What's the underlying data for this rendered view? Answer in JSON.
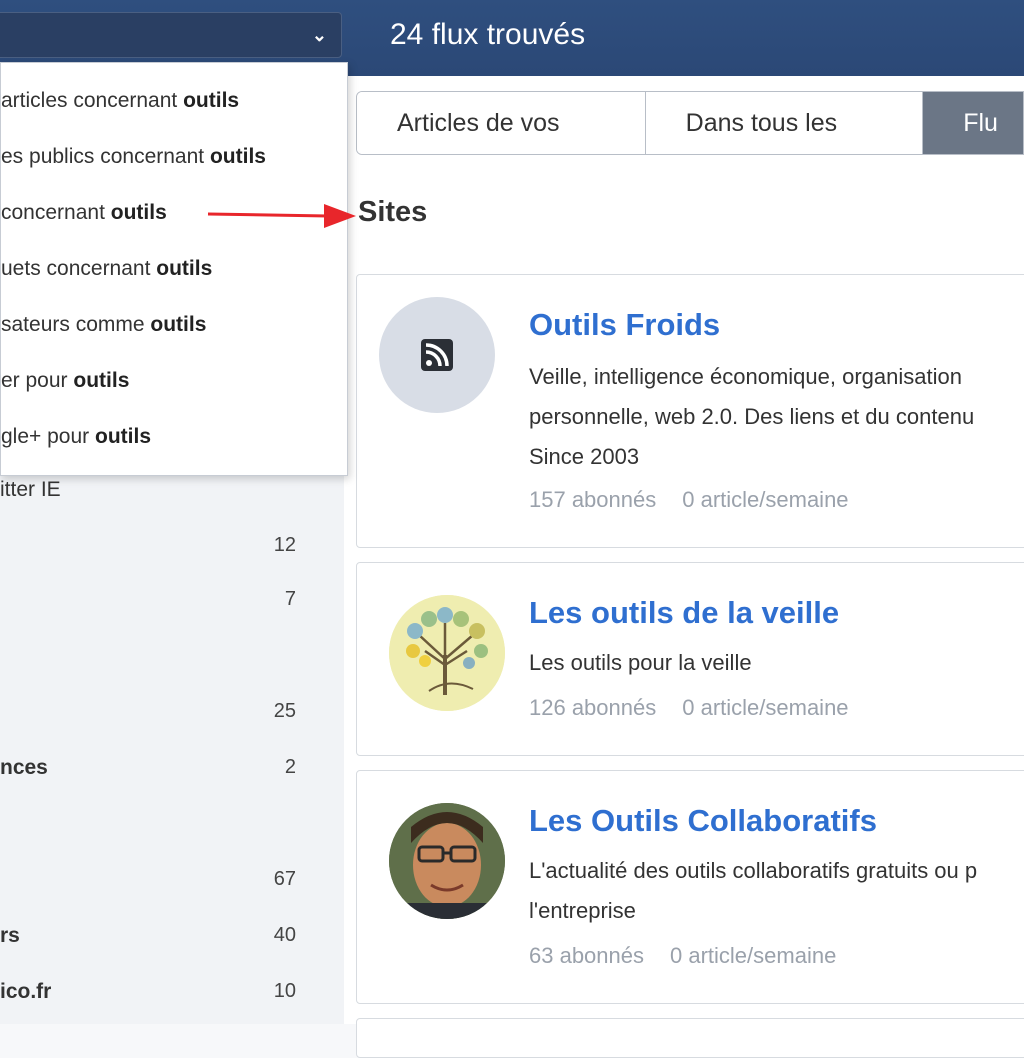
{
  "header": {
    "result_count": "24 flux trouvés"
  },
  "dropdown": {
    "items": [
      {
        "prefix": "articles concernant ",
        "keyword": "outils"
      },
      {
        "prefix": "es publics concernant ",
        "keyword": "outils"
      },
      {
        "prefix": "concernant ",
        "keyword": "outils"
      },
      {
        "prefix": "uets concernant ",
        "keyword": "outils"
      },
      {
        "prefix": "sateurs comme ",
        "keyword": "outils"
      },
      {
        "prefix": "er pour ",
        "keyword": "outils"
      },
      {
        "prefix": "gle+ pour ",
        "keyword": "outils"
      }
    ]
  },
  "sidebar": {
    "items": [
      {
        "label": "itter IE",
        "count": ""
      },
      {
        "label": "",
        "count": "12"
      },
      {
        "label": "",
        "count": "7"
      },
      {
        "label": "",
        "count": "25"
      },
      {
        "label": "nces",
        "count": "2"
      },
      {
        "label": "",
        "count": "67"
      },
      {
        "label": "rs",
        "count": "40"
      },
      {
        "label": "ico.fr",
        "count": "10"
      }
    ]
  },
  "tabs": [
    {
      "label": "Articles de vos flux"
    },
    {
      "label": "Dans tous les flux"
    },
    {
      "label": "Flu"
    }
  ],
  "section_title": "Sites",
  "feeds": [
    {
      "title": "Outils Froids",
      "desc_lines": [
        "Veille, intelligence économique, organisation",
        "personnelle, web 2.0. Des liens et du contenu",
        "Since 2003"
      ],
      "subscribers": "157 abonnés",
      "rate": "0 article/semaine",
      "avatar": "rss-icon"
    },
    {
      "title": "Les outils de la veille",
      "desc_lines": [
        "Les outils pour la veille"
      ],
      "subscribers": "126 abonnés",
      "rate": "0 article/semaine",
      "avatar": "tree-logo"
    },
    {
      "title": "Les Outils Collaboratifs",
      "desc_lines": [
        "L'actualité des outils collaboratifs gratuits ou p",
        "l'entreprise"
      ],
      "subscribers": "63 abonnés",
      "rate": "0 article/semaine",
      "avatar": "person-photo"
    }
  ],
  "colors": {
    "header_bg": "#2f4f7f",
    "link": "#2f6fd0",
    "active_tab": "#6b7686",
    "annotation_arrow": "#e8262b"
  }
}
